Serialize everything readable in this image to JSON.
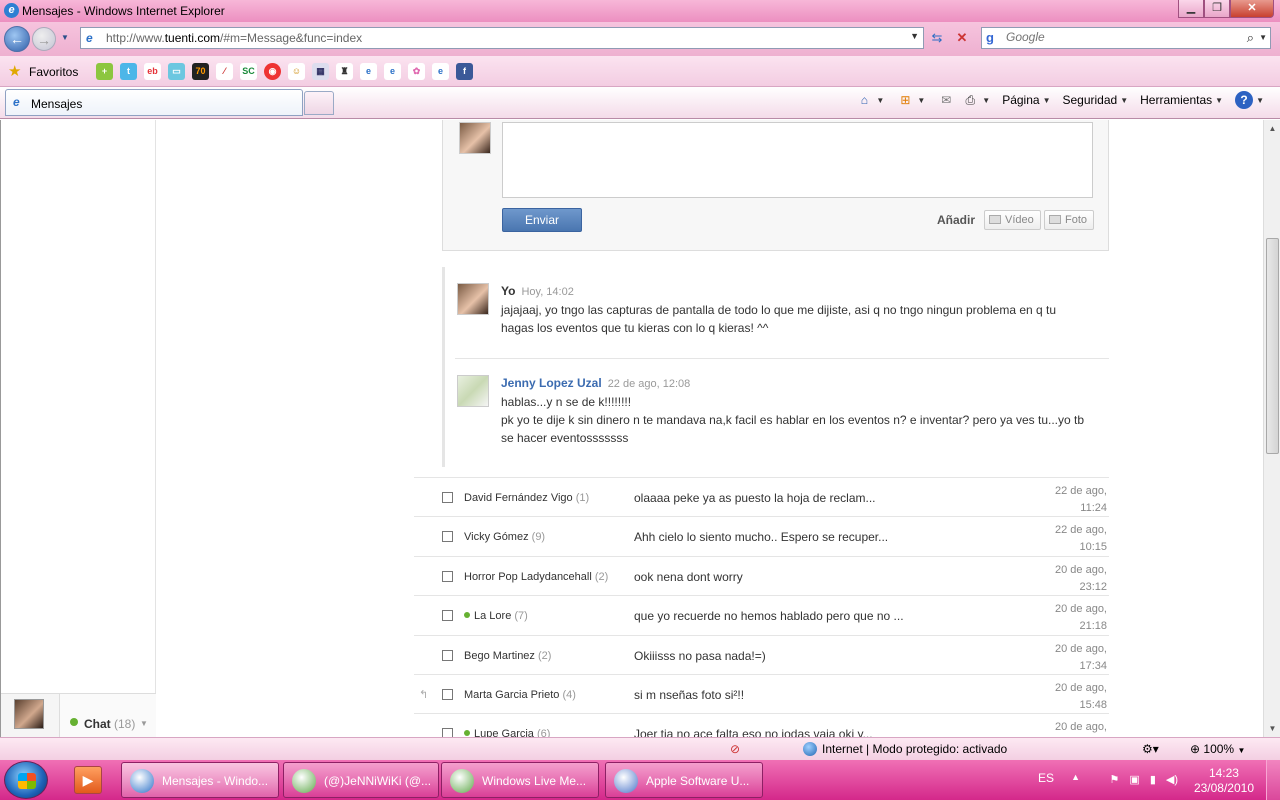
{
  "window": {
    "title": "Mensajes - Windows Internet Explorer"
  },
  "address": {
    "url_prefix": "http://www.",
    "url_domain": "tuenti.com",
    "url_suffix": "/#m=Message&func=index",
    "search_placeholder": "Google"
  },
  "favorites": {
    "label": "Favoritos"
  },
  "tab": {
    "label": "Mensajes"
  },
  "commands": {
    "page": "Página",
    "security": "Seguridad",
    "tools": "Herramientas"
  },
  "compose": {
    "send": "Enviar",
    "add": "Añadir",
    "video": "Vídeo",
    "photo": "Foto"
  },
  "thread": [
    {
      "name": "Yo",
      "time": "Hoy, 14:02",
      "body": "jajajaaj, yo tngo las capturas de pantalla de todo lo que me dijiste, asi q no tngo ningun problema en q tu hagas los eventos que tu kieras con lo q kieras! ^^",
      "name_color": "#333333"
    },
    {
      "name": "Jenny Lopez Uzal",
      "time": "22 de ago, 12:08",
      "body": "hablas...y n se de k!!!!!!!!\npk yo te dije k sin dinero n te mandava na,k facil es hablar en los eventos n? e inventar? pero ya ves tu...yo tb se hacer eventosssssss",
      "name_color": "#3b6bb0"
    }
  ],
  "inbox": [
    {
      "sender": "David Fernández Vigo",
      "count": "(1)",
      "preview": "olaaaa peke  ya as puesto la  hoja de  reclam...",
      "date1": "22 de ago,",
      "date2": "11:24",
      "online": false,
      "replied": false
    },
    {
      "sender": "Vicky Gómez",
      "count": "(9)",
      "preview": "Ahh cielo lo siento mucho.. Espero se recuper...",
      "date1": "22 de ago,",
      "date2": "10:15",
      "online": false,
      "replied": false
    },
    {
      "sender": "Horror Pop Ladydancehall",
      "count": "(2)",
      "preview": "ook nena dont worry",
      "date1": "20 de ago,",
      "date2": "23:12",
      "online": false,
      "replied": false
    },
    {
      "sender": "La Lore",
      "count": "(7)",
      "preview": "que yo recuerde no hemos hablado pero que no ...",
      "date1": "20 de ago,",
      "date2": "21:18",
      "online": true,
      "replied": false
    },
    {
      "sender": "Bego Martinez",
      "count": "(2)",
      "preview": "Okiiisss no pasa nada!=)",
      "date1": "20 de ago,",
      "date2": "17:34",
      "online": false,
      "replied": false
    },
    {
      "sender": "Marta Garcia Prieto",
      "count": "(4)",
      "preview": "si m nseñas foto si²!!",
      "date1": "20 de ago,",
      "date2": "15:48",
      "online": false,
      "replied": true
    },
    {
      "sender": "Lupe Garcia",
      "count": "(6)",
      "preview": "Joer tia no ace falta eso no jodas vaja oki y...",
      "date1": "20 de ago,",
      "date2": "",
      "online": true,
      "replied": false
    }
  ],
  "chat": {
    "label": "Chat",
    "count": "(18)"
  },
  "status": {
    "zone": "Internet | Modo protegido: activado",
    "zoom": "100%"
  },
  "taskbar": {
    "items": [
      {
        "label": "Mensajes - Windo...",
        "icon_color": "#2b71c8",
        "active": true
      },
      {
        "label": "(@)JeNNiWiKi (@...",
        "icon_color": "#5fa84a",
        "active": false
      },
      {
        "label": "Windows Live Me...",
        "icon_color": "#5fa84a",
        "active": false
      },
      {
        "label": "Apple Software U...",
        "icon_color": "#4a74c9",
        "active": false
      }
    ],
    "lang": "ES",
    "time": "14:23",
    "date": "23/08/2010"
  }
}
